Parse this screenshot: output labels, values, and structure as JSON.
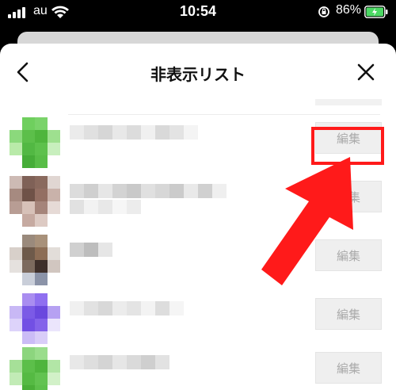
{
  "status_bar": {
    "carrier": "au",
    "time": "10:54",
    "battery_percent": "86%",
    "icons": [
      "signal-icon",
      "wifi-icon",
      "rotation-lock-icon",
      "battery-charging-icon"
    ]
  },
  "sheet": {
    "title": "非表示リスト",
    "back_icon": "chevron-left-icon",
    "close_icon": "close-icon"
  },
  "rows": [
    {
      "edit_label": "編集",
      "avatar_color": "#5cbf4a"
    },
    {
      "edit_label": "編集",
      "avatar_color": "#8a6a5e"
    },
    {
      "edit_label": "編集",
      "avatar_color": "#6e5a4a"
    },
    {
      "edit_label": "編集",
      "avatar_color": "#7b5ae6"
    },
    {
      "edit_label": "編集",
      "avatar_color": "#5cbf4a"
    }
  ],
  "annotation": {
    "highlight_color": "#ff1a1a",
    "arrow_color": "#ff1a1a"
  }
}
